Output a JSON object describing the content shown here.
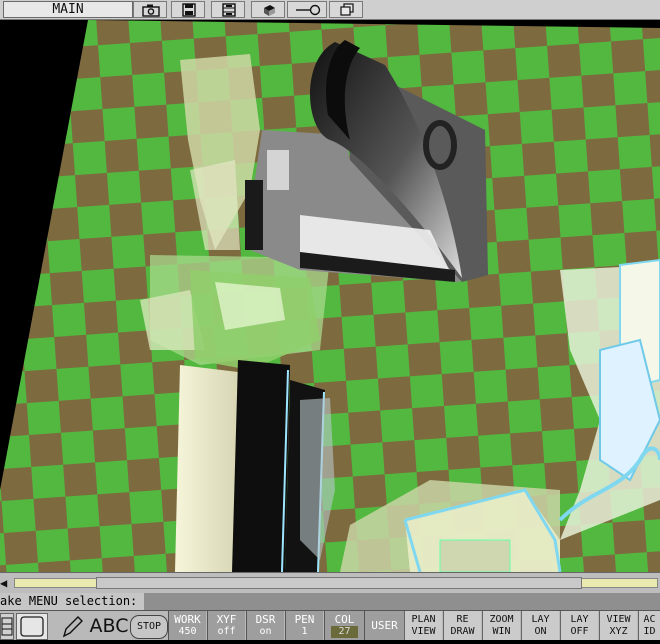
{
  "topbar": {
    "menu_label": "MAIN",
    "icons": [
      "camera-icon",
      "disk-icon",
      "film-icon",
      "cube-icon",
      "key-icon",
      "windows-icon"
    ]
  },
  "status": {
    "prompt": "ake MENU selection:"
  },
  "bottombar": {
    "stop_label": "STOP",
    "text_tool_label": "ABC",
    "fields": [
      {
        "label": "WORK",
        "value": "450"
      },
      {
        "label": "XYF",
        "value": "off"
      },
      {
        "label": "DSR",
        "value": "on"
      },
      {
        "label": "PEN",
        "value": "1"
      },
      {
        "label": "COL",
        "value": "27"
      }
    ],
    "user_label": "USER",
    "commands": [
      {
        "top": "PLAN",
        "bottom": "VIEW"
      },
      {
        "top": "RE",
        "bottom": "DRAW"
      },
      {
        "top": "ZOOM",
        "bottom": "WIN"
      },
      {
        "top": "LAY",
        "bottom": "ON"
      },
      {
        "top": "LAY",
        "bottom": "OFF"
      },
      {
        "top": "VIEW",
        "bottom": "XYZ"
      },
      {
        "top": "AC",
        "bottom": "ID"
      }
    ]
  },
  "colors": {
    "checker_green": "#52b83f",
    "checker_olive": "#7d6a3f",
    "model_dark": "#1a1a1a",
    "model_cream": "#f1f0d2",
    "wire_cyan": "#7fd8f0"
  }
}
